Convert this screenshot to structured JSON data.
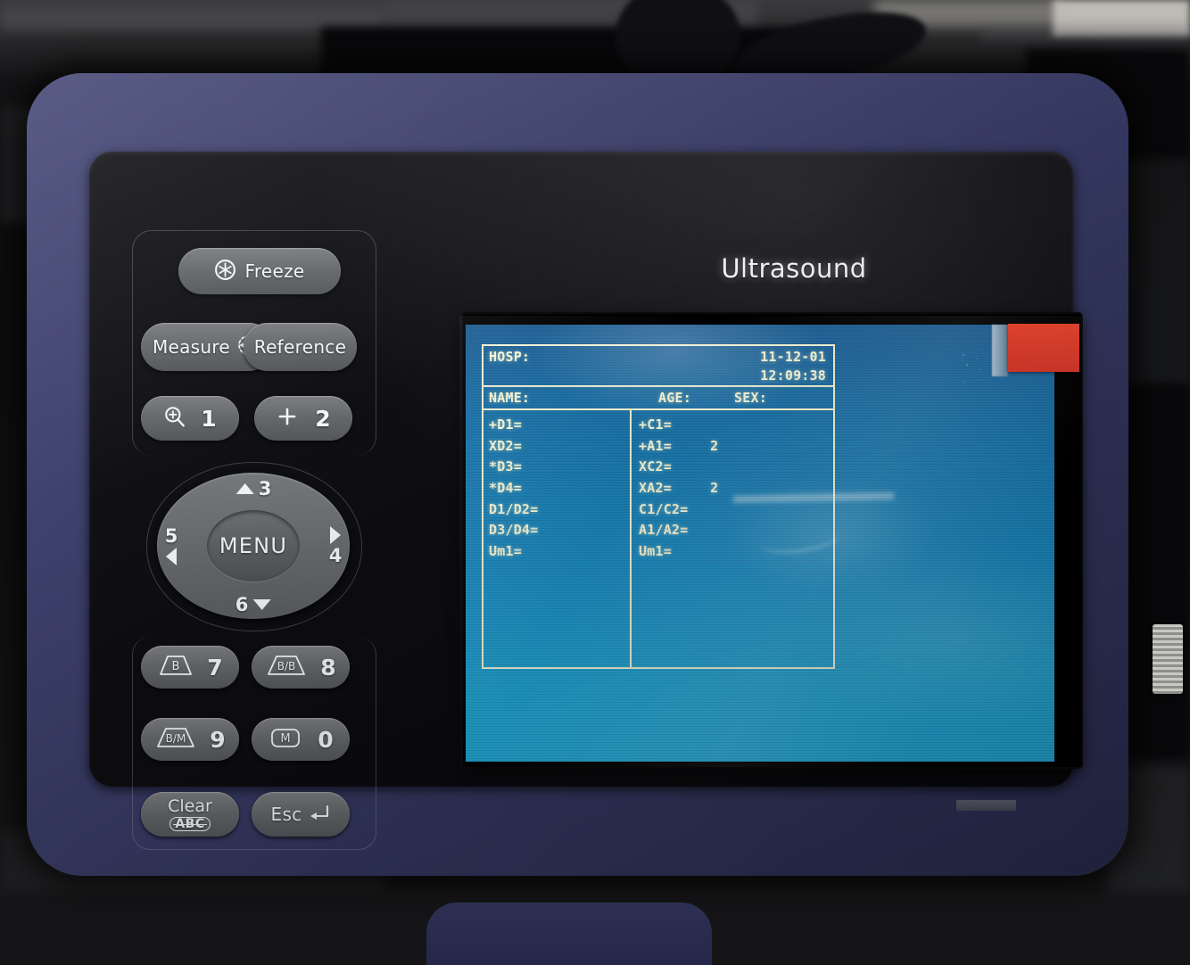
{
  "device": {
    "brand": "Ultrasound"
  },
  "keypad": {
    "freeze": {
      "label": "Freeze",
      "icon": "freeze-snowflake-icon"
    },
    "measure": {
      "label": "Measure",
      "icon": "caliper-icon"
    },
    "reference": {
      "label": "Reference"
    },
    "zoom": {
      "number": "1",
      "icon": "magnifier-plus-icon"
    },
    "plus": {
      "number": "2",
      "icon": "plus-icon"
    },
    "b_mode": {
      "mode": "B",
      "number": "7",
      "icon": "sector-probe-icon"
    },
    "bb_mode": {
      "mode": "B/B",
      "number": "8",
      "icon": "sector-probe-icon"
    },
    "bm_mode": {
      "mode": "B/M",
      "number": "9",
      "icon": "sector-probe-icon"
    },
    "m_mode": {
      "mode": "M",
      "number": "0",
      "icon": "m-mode-icon"
    },
    "clear": {
      "label": "Clear",
      "sub": "ABC"
    },
    "esc": {
      "label": "Esc",
      "icon": "return-arrow-icon"
    },
    "dpad": {
      "center": "MENU",
      "up": "3",
      "right": "4",
      "left": "5",
      "down": "6"
    }
  },
  "screen": {
    "header": {
      "hosp_label": "HOSP:",
      "hosp_value": "",
      "date": "11-12-01",
      "time": "12:09:38",
      "name_label": "NAME:",
      "name_value": "",
      "age_label": "AGE:",
      "age_value": "",
      "sex_label": "SEX:",
      "sex_value": ""
    },
    "measurements": {
      "left": [
        {
          "label": "+D1=",
          "value": ""
        },
        {
          "label": "XD2=",
          "value": ""
        },
        {
          "label": "*D3=",
          "value": ""
        },
        {
          "label": "*D4=",
          "value": ""
        },
        {
          "label": "D1/D2=",
          "value": ""
        },
        {
          "label": "D3/D4=",
          "value": ""
        },
        {
          "label": "Um1=",
          "value": ""
        }
      ],
      "right": [
        {
          "label": "+C1=",
          "value": ""
        },
        {
          "label": "+A1=",
          "value": "2"
        },
        {
          "label": "XC2=",
          "value": ""
        },
        {
          "label": "XA2=",
          "value": "2"
        },
        {
          "label": "C1/C2=",
          "value": ""
        },
        {
          "label": "A1/A2=",
          "value": ""
        },
        {
          "label": "Um1=",
          "value": ""
        }
      ]
    },
    "colors": {
      "osd_text": "#fbfbdc",
      "lcd_top": "#1d5f96",
      "lcd_bottom": "#23aad8",
      "film_tab": "#e8462f"
    }
  }
}
